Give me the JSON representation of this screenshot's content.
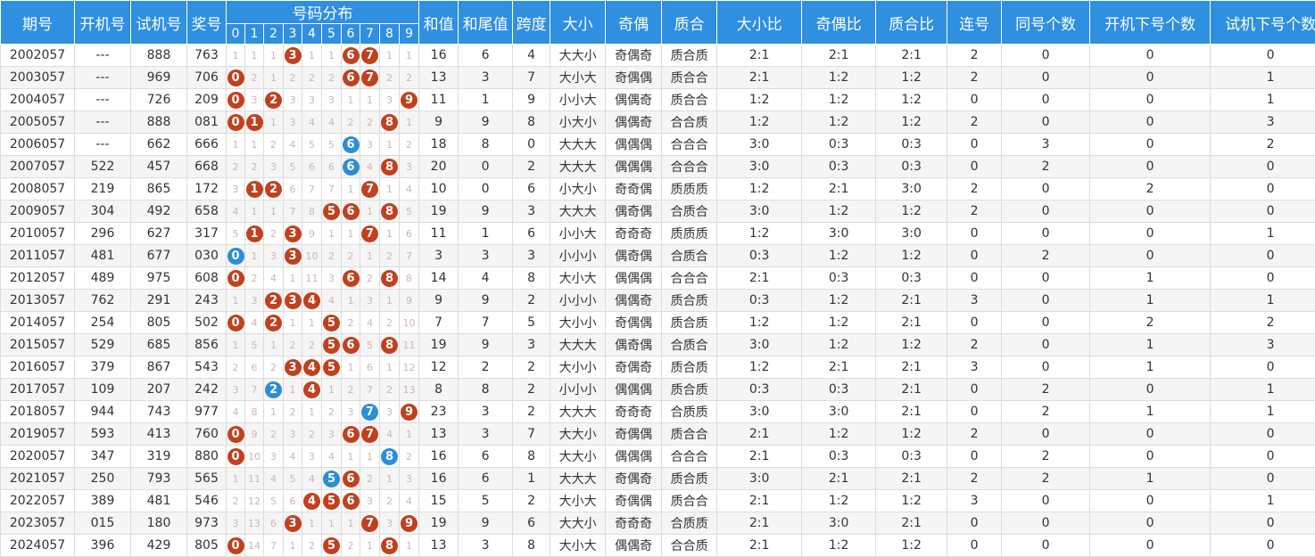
{
  "headers": {
    "period": "期号",
    "open_machine": "开机号",
    "test_machine": "试机号",
    "prize": "奖号",
    "distribution": "号码分布",
    "digits": [
      "0",
      "1",
      "2",
      "3",
      "4",
      "5",
      "6",
      "7",
      "8",
      "9"
    ],
    "sum": "和值",
    "sum_tail": "和尾值",
    "span": "跨度",
    "size": "大小",
    "odd_even": "奇偶",
    "prime_composite": "质合",
    "size_ratio": "大小比",
    "odd_even_ratio": "奇偶比",
    "prime_ratio": "质合比",
    "consecutive": "连号",
    "same_count": "同号个数",
    "open_next_count": "开机下号个数",
    "test_next_count": "试机下号个数"
  },
  "colors": {
    "header_bg": "#2f8fe0",
    "ball_red": "#c1401e",
    "ball_blue": "#2c8ed6"
  },
  "rows": [
    {
      "period": "2002057",
      "open": "---",
      "test": "888",
      "prize": "763",
      "dist": [
        "1",
        "1",
        "1",
        "B:3",
        "1",
        "1",
        "B:6",
        "B:7",
        "1",
        "1"
      ],
      "sum": "16",
      "tail": "6",
      "span": "4",
      "size": "大大小",
      "oe": "奇偶奇",
      "pc": "质合质",
      "sr": "2:1",
      "oer": "2:1",
      "pcr": "2:1",
      "cons": "2",
      "same": "0",
      "on": "0",
      "tn": "0"
    },
    {
      "period": "2003057",
      "open": "---",
      "test": "969",
      "prize": "706",
      "dist": [
        "B:0",
        "2",
        "1",
        "2",
        "2",
        "2",
        "B:6",
        "B:7",
        "2",
        "2"
      ],
      "sum": "13",
      "tail": "3",
      "span": "7",
      "size": "大小大",
      "oe": "奇偶偶",
      "pc": "质合合",
      "sr": "2:1",
      "oer": "1:2",
      "pcr": "1:2",
      "cons": "2",
      "same": "0",
      "on": "0",
      "tn": "1"
    },
    {
      "period": "2004057",
      "open": "---",
      "test": "726",
      "prize": "209",
      "dist": [
        "B:0",
        "3",
        "B:2",
        "3",
        "3",
        "3",
        "1",
        "1",
        "3",
        "B:9"
      ],
      "sum": "11",
      "tail": "1",
      "span": "9",
      "size": "小小大",
      "oe": "偶偶奇",
      "pc": "质合合",
      "sr": "1:2",
      "oer": "1:2",
      "pcr": "1:2",
      "cons": "0",
      "same": "0",
      "on": "0",
      "tn": "1"
    },
    {
      "period": "2005057",
      "open": "---",
      "test": "888",
      "prize": "081",
      "dist": [
        "B:0",
        "B:1",
        "1",
        "3",
        "4",
        "4",
        "2",
        "2",
        "B:8",
        "1"
      ],
      "sum": "9",
      "tail": "9",
      "span": "8",
      "size": "小大小",
      "oe": "偶偶奇",
      "pc": "合合质",
      "sr": "1:2",
      "oer": "1:2",
      "pcr": "1:2",
      "cons": "2",
      "same": "0",
      "on": "0",
      "tn": "3"
    },
    {
      "period": "2006057",
      "open": "---",
      "test": "662",
      "prize": "666",
      "dist": [
        "1",
        "1",
        "2",
        "4",
        "5",
        "5",
        "U:6",
        "3",
        "1",
        "2"
      ],
      "sum": "18",
      "tail": "8",
      "span": "0",
      "size": "大大大",
      "oe": "偶偶偶",
      "pc": "合合合",
      "sr": "3:0",
      "oer": "0:3",
      "pcr": "0:3",
      "cons": "0",
      "same": "3",
      "on": "0",
      "tn": "2"
    },
    {
      "period": "2007057",
      "open": "522",
      "test": "457",
      "prize": "668",
      "dist": [
        "2",
        "2",
        "3",
        "5",
        "6",
        "6",
        "U:6",
        "4",
        "B:8",
        "3"
      ],
      "sum": "20",
      "tail": "0",
      "span": "2",
      "size": "大大大",
      "oe": "偶偶偶",
      "pc": "合合合",
      "sr": "3:0",
      "oer": "0:3",
      "pcr": "0:3",
      "cons": "0",
      "same": "2",
      "on": "0",
      "tn": "0"
    },
    {
      "period": "2008057",
      "open": "219",
      "test": "865",
      "prize": "172",
      "dist": [
        "3",
        "B:1",
        "B:2",
        "6",
        "7",
        "7",
        "1",
        "B:7",
        "1",
        "4"
      ],
      "sum": "10",
      "tail": "0",
      "span": "6",
      "size": "小大小",
      "oe": "奇奇偶",
      "pc": "质质质",
      "sr": "1:2",
      "oer": "2:1",
      "pcr": "3:0",
      "cons": "2",
      "same": "0",
      "on": "2",
      "tn": "0"
    },
    {
      "period": "2009057",
      "open": "304",
      "test": "492",
      "prize": "658",
      "dist": [
        "4",
        "1",
        "1",
        "7",
        "8",
        "B:5",
        "B:6",
        "1",
        "B:8",
        "5"
      ],
      "sum": "19",
      "tail": "9",
      "span": "3",
      "size": "大大大",
      "oe": "偶奇偶",
      "pc": "合质合",
      "sr": "3:0",
      "oer": "1:2",
      "pcr": "1:2",
      "cons": "2",
      "same": "0",
      "on": "0",
      "tn": "0"
    },
    {
      "period": "2010057",
      "open": "296",
      "test": "627",
      "prize": "317",
      "dist": [
        "5",
        "B:1",
        "2",
        "B:3",
        "9",
        "1",
        "1",
        "B:7",
        "1",
        "6"
      ],
      "sum": "11",
      "tail": "1",
      "span": "6",
      "size": "小小大",
      "oe": "奇奇奇",
      "pc": "质质质",
      "sr": "1:2",
      "oer": "3:0",
      "pcr": "3:0",
      "cons": "0",
      "same": "0",
      "on": "0",
      "tn": "1"
    },
    {
      "period": "2011057",
      "open": "481",
      "test": "677",
      "prize": "030",
      "dist": [
        "U:0",
        "1",
        "3",
        "B:3",
        "10",
        "2",
        "2",
        "1",
        "2",
        "7"
      ],
      "sum": "3",
      "tail": "3",
      "span": "3",
      "size": "小小小",
      "oe": "偶奇偶",
      "pc": "合质合",
      "sr": "0:3",
      "oer": "1:2",
      "pcr": "1:2",
      "cons": "0",
      "same": "2",
      "on": "0",
      "tn": "0"
    },
    {
      "period": "2012057",
      "open": "489",
      "test": "975",
      "prize": "608",
      "dist": [
        "B:0",
        "2",
        "4",
        "1",
        "11",
        "3",
        "B:6",
        "2",
        "B:8",
        "8"
      ],
      "sum": "14",
      "tail": "4",
      "span": "8",
      "size": "大小大",
      "oe": "偶偶偶",
      "pc": "合合合",
      "sr": "2:1",
      "oer": "0:3",
      "pcr": "0:3",
      "cons": "0",
      "same": "0",
      "on": "1",
      "tn": "0"
    },
    {
      "period": "2013057",
      "open": "762",
      "test": "291",
      "prize": "243",
      "dist": [
        "1",
        "3",
        "B:2",
        "B:3",
        "B:4",
        "4",
        "1",
        "3",
        "1",
        "9"
      ],
      "sum": "9",
      "tail": "9",
      "span": "2",
      "size": "小小小",
      "oe": "偶偶奇",
      "pc": "质合质",
      "sr": "0:3",
      "oer": "1:2",
      "pcr": "2:1",
      "cons": "3",
      "same": "0",
      "on": "1",
      "tn": "1"
    },
    {
      "period": "2014057",
      "open": "254",
      "test": "805",
      "prize": "502",
      "dist": [
        "B:0",
        "4",
        "B:2",
        "1",
        "1",
        "B:5",
        "2",
        "4",
        "2",
        "10"
      ],
      "sum": "7",
      "tail": "7",
      "span": "5",
      "size": "大小小",
      "oe": "奇偶偶",
      "pc": "质合质",
      "sr": "1:2",
      "oer": "1:2",
      "pcr": "2:1",
      "cons": "0",
      "same": "0",
      "on": "2",
      "tn": "2"
    },
    {
      "period": "2015057",
      "open": "529",
      "test": "685",
      "prize": "856",
      "dist": [
        "1",
        "5",
        "1",
        "2",
        "2",
        "B:5",
        "B:6",
        "5",
        "B:8",
        "11"
      ],
      "sum": "19",
      "tail": "9",
      "span": "3",
      "size": "大大大",
      "oe": "偶奇偶",
      "pc": "合质合",
      "sr": "3:0",
      "oer": "1:2",
      "pcr": "1:2",
      "cons": "2",
      "same": "0",
      "on": "1",
      "tn": "3"
    },
    {
      "period": "2016057",
      "open": "379",
      "test": "867",
      "prize": "543",
      "dist": [
        "2",
        "6",
        "2",
        "B:3",
        "B:4",
        "B:5",
        "1",
        "6",
        "1",
        "12"
      ],
      "sum": "12",
      "tail": "2",
      "span": "2",
      "size": "大小小",
      "oe": "奇偶奇",
      "pc": "质合质",
      "sr": "1:2",
      "oer": "2:1",
      "pcr": "2:1",
      "cons": "3",
      "same": "0",
      "on": "1",
      "tn": "0"
    },
    {
      "period": "2017057",
      "open": "109",
      "test": "207",
      "prize": "242",
      "dist": [
        "3",
        "7",
        "U:2",
        "1",
        "B:4",
        "1",
        "2",
        "7",
        "2",
        "13"
      ],
      "sum": "8",
      "tail": "8",
      "span": "2",
      "size": "小小小",
      "oe": "偶偶偶",
      "pc": "质合质",
      "sr": "0:3",
      "oer": "0:3",
      "pcr": "2:1",
      "cons": "0",
      "same": "2",
      "on": "0",
      "tn": "1"
    },
    {
      "period": "2018057",
      "open": "944",
      "test": "743",
      "prize": "977",
      "dist": [
        "4",
        "8",
        "1",
        "2",
        "1",
        "2",
        "3",
        "U:7",
        "3",
        "B:9"
      ],
      "sum": "23",
      "tail": "3",
      "span": "2",
      "size": "大大大",
      "oe": "奇奇奇",
      "pc": "合质质",
      "sr": "3:0",
      "oer": "3:0",
      "pcr": "2:1",
      "cons": "0",
      "same": "2",
      "on": "1",
      "tn": "1"
    },
    {
      "period": "2019057",
      "open": "593",
      "test": "413",
      "prize": "760",
      "dist": [
        "B:0",
        "9",
        "2",
        "3",
        "2",
        "3",
        "B:6",
        "B:7",
        "4",
        "1"
      ],
      "sum": "13",
      "tail": "3",
      "span": "7",
      "size": "大大小",
      "oe": "奇偶偶",
      "pc": "质合合",
      "sr": "2:1",
      "oer": "1:2",
      "pcr": "1:2",
      "cons": "2",
      "same": "0",
      "on": "0",
      "tn": "0"
    },
    {
      "period": "2020057",
      "open": "347",
      "test": "319",
      "prize": "880",
      "dist": [
        "B:0",
        "10",
        "3",
        "4",
        "3",
        "4",
        "1",
        "1",
        "U:8",
        "2"
      ],
      "sum": "16",
      "tail": "6",
      "span": "8",
      "size": "大大小",
      "oe": "偶偶偶",
      "pc": "合合合",
      "sr": "2:1",
      "oer": "0:3",
      "pcr": "0:3",
      "cons": "0",
      "same": "2",
      "on": "0",
      "tn": "0"
    },
    {
      "period": "2021057",
      "open": "250",
      "test": "793",
      "prize": "565",
      "dist": [
        "1",
        "11",
        "4",
        "5",
        "4",
        "U:5",
        "B:6",
        "2",
        "1",
        "3"
      ],
      "sum": "16",
      "tail": "6",
      "span": "1",
      "size": "大大大",
      "oe": "奇偶奇",
      "pc": "质合质",
      "sr": "3:0",
      "oer": "2:1",
      "pcr": "2:1",
      "cons": "2",
      "same": "2",
      "on": "1",
      "tn": "0"
    },
    {
      "period": "2022057",
      "open": "389",
      "test": "481",
      "prize": "546",
      "dist": [
        "2",
        "12",
        "5",
        "6",
        "B:4",
        "B:5",
        "B:6",
        "3",
        "2",
        "4"
      ],
      "sum": "15",
      "tail": "5",
      "span": "2",
      "size": "大小大",
      "oe": "奇偶偶",
      "pc": "质合合",
      "sr": "2:1",
      "oer": "1:2",
      "pcr": "1:2",
      "cons": "3",
      "same": "0",
      "on": "0",
      "tn": "1"
    },
    {
      "period": "2023057",
      "open": "015",
      "test": "180",
      "prize": "973",
      "dist": [
        "3",
        "13",
        "6",
        "B:3",
        "1",
        "1",
        "1",
        "B:7",
        "3",
        "B:9"
      ],
      "sum": "19",
      "tail": "9",
      "span": "6",
      "size": "大大小",
      "oe": "奇奇奇",
      "pc": "合质质",
      "sr": "2:1",
      "oer": "3:0",
      "pcr": "2:1",
      "cons": "0",
      "same": "0",
      "on": "0",
      "tn": "0"
    },
    {
      "period": "2024057",
      "open": "396",
      "test": "429",
      "prize": "805",
      "dist": [
        "B:0",
        "14",
        "7",
        "1",
        "2",
        "B:5",
        "2",
        "1",
        "B:8",
        "1"
      ],
      "sum": "13",
      "tail": "3",
      "span": "8",
      "size": "大小大",
      "oe": "偶偶奇",
      "pc": "合合质",
      "sr": "2:1",
      "oer": "1:2",
      "pcr": "1:2",
      "cons": "0",
      "same": "0",
      "on": "0",
      "tn": "0"
    }
  ]
}
